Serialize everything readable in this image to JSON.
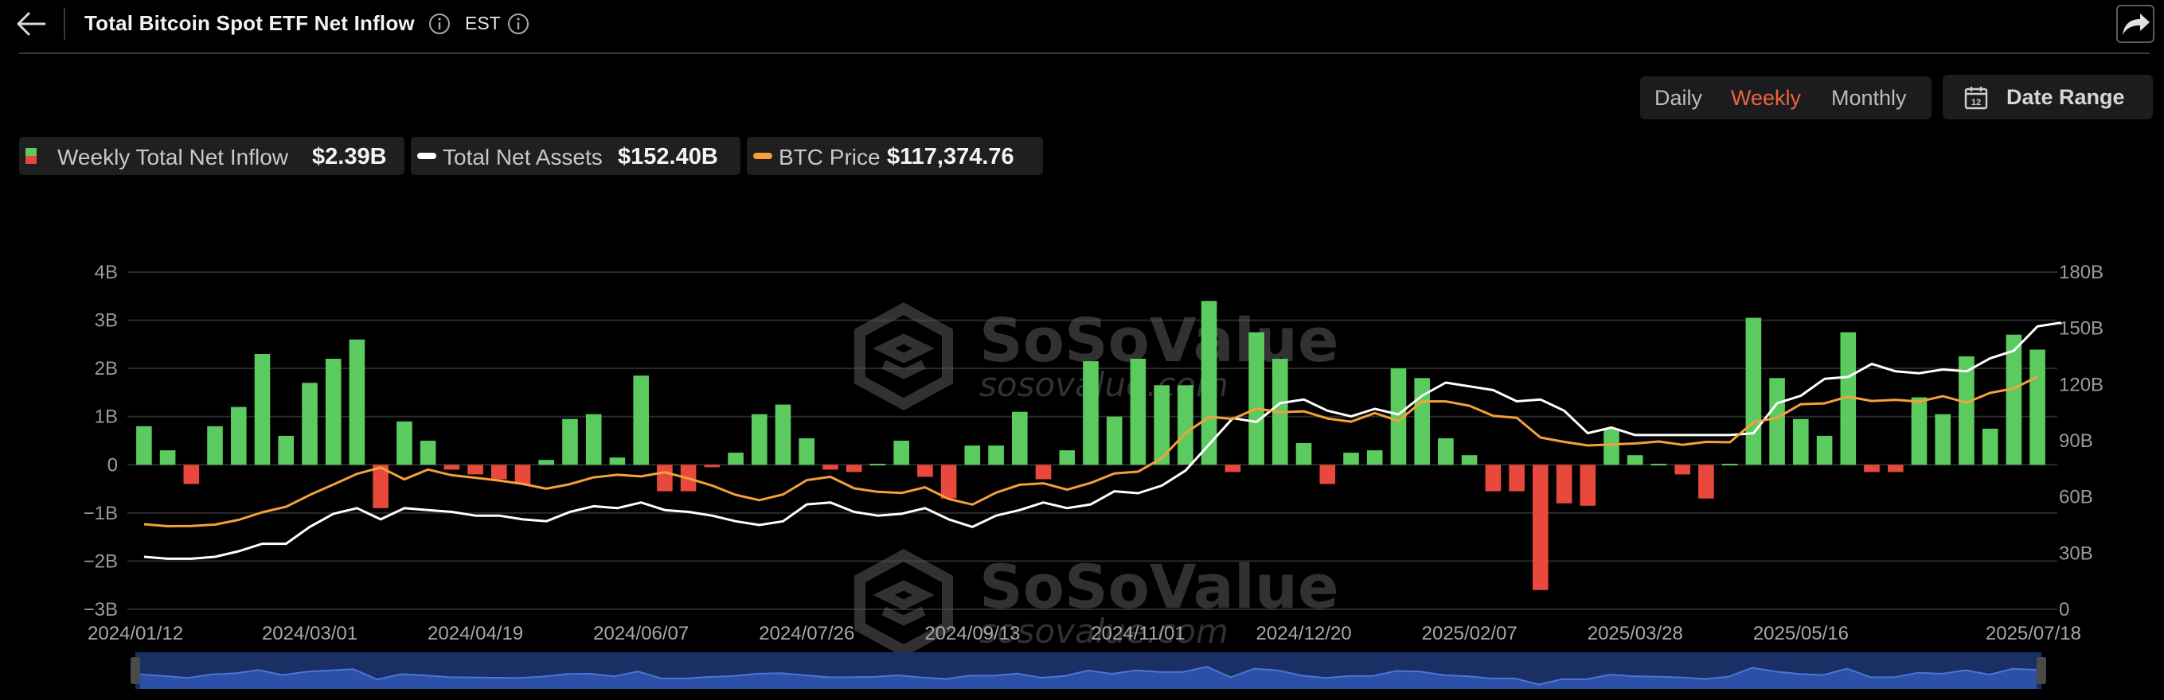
{
  "header": {
    "title": "Total Bitcoin Spot ETF Net Inflow",
    "timezone": "EST"
  },
  "period_tabs": [
    {
      "label": "Daily",
      "active": false
    },
    {
      "label": "Weekly",
      "active": true
    },
    {
      "label": "Monthly",
      "active": false
    }
  ],
  "date_range_label": "Date Range",
  "legend": {
    "inflow": {
      "label": "Weekly Total Net Inflow",
      "value": "$2.39B"
    },
    "assets": {
      "label": "Total Net Assets",
      "value": "$152.40B"
    },
    "price": {
      "label": "BTC Price",
      "value": "$117,374.76"
    }
  },
  "watermark": {
    "brand": "SoSoValue",
    "url": "sosovalue.com"
  },
  "colors": {
    "positive_bar": "#5ccb5f",
    "negative_bar": "#e8493c",
    "assets_line": "#ffffff",
    "price_line": "#f5a03a",
    "active_tab": "#f0623e",
    "navigator_fill": "#1e3a78"
  },
  "icons": [
    "back-arrow-icon",
    "info-icon",
    "share-icon",
    "calendar-icon",
    "legend-swatch-icon"
  ],
  "chart_data": {
    "type": "bar",
    "title": "",
    "xlabel": "",
    "ylabel": "",
    "ylim": [
      -3,
      4
    ],
    "y_ticks": [
      "4B",
      "3B",
      "2B",
      "1B",
      "0",
      "−1B",
      "−2B",
      "−3B"
    ],
    "y2lim": [
      0,
      180
    ],
    "y2_ticks": [
      "180B",
      "150B",
      "120B",
      "90B",
      "60B",
      "30B",
      "0"
    ],
    "x_tick_labels": [
      "2024/01/12",
      "2024/03/01",
      "2024/04/19",
      "2024/06/07",
      "2024/07/26",
      "2024/09/13",
      "2024/11/01",
      "2024/12/20",
      "2025/02/07",
      "2025/03/28",
      "2025/05/16",
      "2025/07/18"
    ],
    "grid": true,
    "legend_position": "top-left",
    "series": [
      {
        "name": "Weekly Total Net Inflow",
        "unit": "B USD",
        "values": [
          0.8,
          0.3,
          -0.4,
          0.8,
          1.2,
          2.3,
          0.6,
          1.7,
          2.2,
          2.6,
          -0.9,
          0.9,
          0.5,
          -0.1,
          -0.2,
          -0.3,
          -0.4,
          0.1,
          0.95,
          1.05,
          0.15,
          1.85,
          -0.55,
          -0.55,
          -0.05,
          0.25,
          1.05,
          1.25,
          0.55,
          -0.1,
          -0.15,
          0.02,
          0.5,
          -0.25,
          -0.7,
          0.4,
          0.4,
          1.1,
          -0.3,
          0.3,
          2.15,
          1.0,
          2.2,
          1.65,
          1.65,
          3.4,
          -0.15,
          2.75,
          2.2,
          0.45,
          -0.4,
          0.25,
          0.3,
          2.0,
          1.8,
          0.55,
          0.2,
          -0.55,
          -0.55,
          -2.6,
          -0.8,
          -0.85,
          0.75,
          0.2,
          0.02,
          -0.2,
          -0.7,
          0.02,
          3.05,
          1.8,
          0.95,
          0.6,
          2.75,
          -0.15,
          -0.15,
          1.4,
          1.05,
          2.25,
          0.75,
          2.7,
          2.39
        ]
      },
      {
        "name": "Total Net Assets",
        "unit": "B USD",
        "values": [
          28,
          27,
          27,
          28,
          31,
          35,
          35,
          44,
          51,
          54,
          48,
          54,
          53,
          52,
          50,
          50,
          48,
          47,
          52,
          55,
          54,
          57,
          53,
          52,
          50,
          47,
          45,
          47,
          56,
          57,
          52,
          50,
          51,
          54,
          48,
          44,
          50,
          53,
          57,
          54,
          56,
          63,
          62,
          66,
          74,
          88,
          102,
          100,
          110,
          112,
          106,
          103,
          107,
          104,
          114,
          121,
          119,
          117,
          111,
          112,
          106,
          94,
          97,
          93,
          93,
          93,
          93,
          93,
          94,
          110,
          114,
          123,
          124,
          131,
          127,
          126,
          128,
          127,
          134,
          138,
          151,
          153
        ]
      },
      {
        "name": "BTC Price",
        "unit": "USD",
        "values": [
          42900,
          41900,
          42000,
          42700,
          45100,
          48900,
          51700,
          57600,
          62900,
          68300,
          71500,
          65500,
          70500,
          67600,
          66300,
          64900,
          63200,
          60800,
          63100,
          66500,
          67800,
          67000,
          69100,
          66000,
          62400,
          57700,
          55000,
          57900,
          65100,
          66800,
          61000,
          59200,
          58600,
          61500,
          55600,
          52800,
          58800,
          62800,
          63500,
          60300,
          63700,
          68500,
          69400,
          76200,
          88800,
          97000,
          96000,
          101200,
          99400,
          99800,
          96200,
          94600,
          98900,
          95000,
          104800,
          104800,
          102600,
          97500,
          96500,
          86600,
          84400,
          82600,
          83100,
          83600,
          84600,
          82900,
          84400,
          84200,
          94300,
          96500,
          103400,
          103800,
          107200,
          105000,
          105600,
          104700,
          107400,
          104200,
          109100,
          111300,
          117374.76
        ]
      }
    ]
  }
}
